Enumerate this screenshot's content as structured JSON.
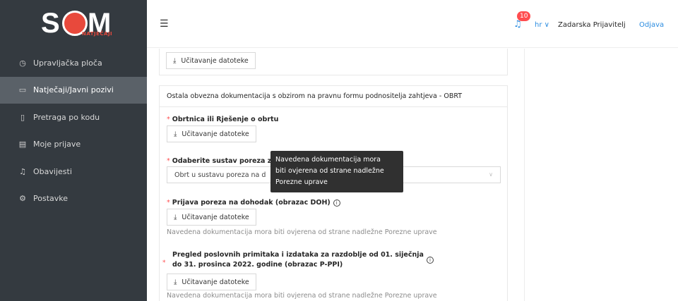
{
  "logo": {
    "text_s": "S",
    "text_m": "M",
    "subtitle": "NATJEČAJI"
  },
  "sidebar": {
    "items": [
      {
        "label": "Upravljačka ploča",
        "icon": "dashboard-icon"
      },
      {
        "label": "Natječaji/Javni pozivi",
        "icon": "folder-icon"
      },
      {
        "label": "Pretraga po kodu",
        "icon": "file-icon"
      },
      {
        "label": "Moje prijave",
        "icon": "document-icon"
      },
      {
        "label": "Obavijesti",
        "icon": "bell-icon"
      },
      {
        "label": "Postavke",
        "icon": "gear-icon"
      }
    ]
  },
  "header": {
    "notification_count": "10",
    "language": "hr ∨",
    "user_name": "Zadarska Prijavitelj",
    "logout": "Odjava"
  },
  "upload_label": "Učitavanje datoteke",
  "section": {
    "title": "Ostala obvezna dokumentacija s obzirom na pravnu formu podnositelja zahtjeva - OBRT",
    "field1_label": "Obrtnica ili Rješenje o obrtu",
    "field2_label": "Odaberite sustav poreza za",
    "field2_value": "Obrt u sustavu poreza na d",
    "field3_label": "Prijava poreza na dohodak (obrazac DOH)",
    "field3_hint": "Navedena dokumentacija mora biti ovjerena od strane nadležne Porezne uprave",
    "field4_label_line1": "Pregled poslovnih primitaka i izdataka za razdoblje od 01. siječnja",
    "field4_label_line2": "do 31. prosinca 2022. godine (obrazac P-PPI)",
    "field4_hint": "Navedena dokumentacija mora biti ovjerena od strane nadležne Porezne uprave"
  },
  "tooltip": {
    "line1": "Navedena dokumentacija mora",
    "line2": "biti ovjerena od strane nadležne",
    "line3": "Porezne uprave"
  }
}
